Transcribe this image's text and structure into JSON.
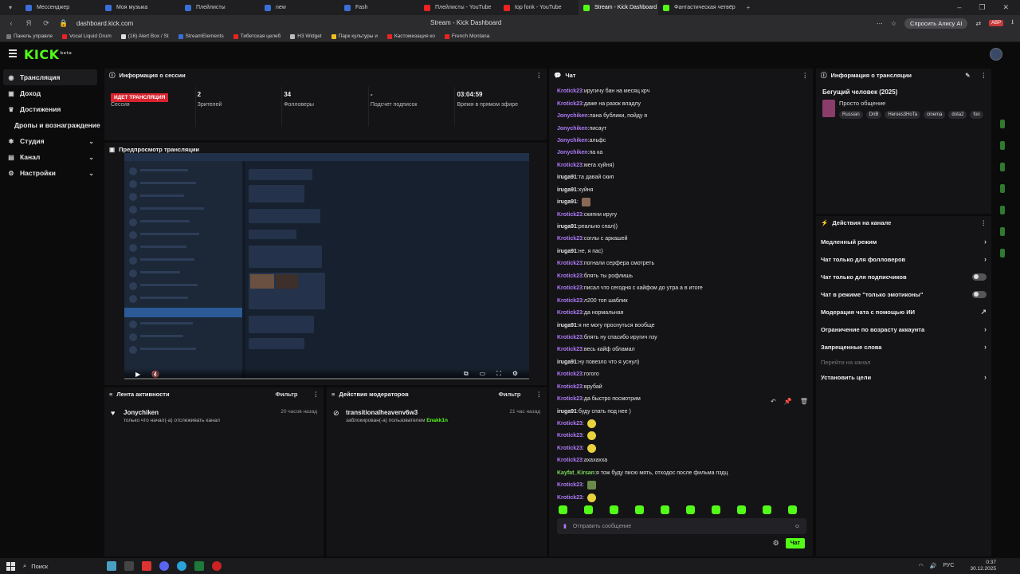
{
  "browser": {
    "tabs": [
      {
        "label": "Мессенджер",
        "color": "#3b6fd8"
      },
      {
        "label": "Моя музыка",
        "color": "#3b6fd8"
      },
      {
        "label": "Плейлисты",
        "color": "#3b6fd8"
      },
      {
        "label": "new",
        "color": "#3b6fd8"
      },
      {
        "label": "Fash",
        "color": "#3b6fd8"
      },
      {
        "label": "Плейлисты - YouTube",
        "color": "#e22"
      },
      {
        "label": "top fonk - YouTube",
        "color": "#e22"
      },
      {
        "label": "Stream - Kick Dashboard",
        "color": "#53fc18"
      },
      {
        "label": "Фантастическая четвёр",
        "color": "#53fc18"
      }
    ],
    "url": "dashboard.kick.com",
    "page_title": "Stream - Kick Dashboard",
    "alisa_label": "Спросить Алису AI",
    "abp": "ABP",
    "bookmarks": [
      {
        "label": "Панель управле",
        "color": "#777"
      },
      {
        "label": "Vocal Liquid Drum",
        "color": "#e22"
      },
      {
        "label": "(16) Alert Box / St",
        "color": "#ddd"
      },
      {
        "label": "StreamElements",
        "color": "#3b6fd8"
      },
      {
        "label": "Тибетская целеб",
        "color": "#e22"
      },
      {
        "label": "H3 Widget",
        "color": "#bbb"
      },
      {
        "label": "Парк культуры и",
        "color": "#f0c020"
      },
      {
        "label": "Кастомизация ко",
        "color": "#e22"
      },
      {
        "label": "French Montana",
        "color": "#e22"
      }
    ]
  },
  "app": {
    "logo": "KICK",
    "logo_sup": "beta"
  },
  "sidebar": {
    "items": [
      {
        "label": "Трансляция",
        "icon": "(•)"
      },
      {
        "label": "Доход",
        "icon": "▣"
      },
      {
        "label": "Достижения",
        "icon": "🏆"
      },
      {
        "label": "Дропы и вознаграждение",
        "icon": ""
      },
      {
        "label": "Студия",
        "icon": "⚙"
      },
      {
        "label": "Канал",
        "icon": "▤"
      },
      {
        "label": "Настройки",
        "icon": "⚙"
      }
    ]
  },
  "session": {
    "title": "Информация о сессии",
    "live_badge": "ИДЕТ ТРАНСЛЯЦИЯ",
    "stats": [
      {
        "value": "",
        "label": "Сессия"
      },
      {
        "value": "2",
        "label": "Зрителей"
      },
      {
        "value": "34",
        "label": "Фолловеры"
      },
      {
        "value": "-",
        "label": "Подсчет подписок"
      },
      {
        "value": "03:04:59",
        "label": "Время в прямом эфире"
      }
    ]
  },
  "preview": {
    "title": "Предпросмотр трансляции"
  },
  "activity": {
    "title": "Лента активности",
    "filter": "Фильтр",
    "items": [
      {
        "name": "Jonychiken",
        "desc": "только что начал(-а) отслеживать канал",
        "time": "20 часов назад"
      }
    ]
  },
  "moderators": {
    "title": "Действия модераторов",
    "filter": "Фильтр",
    "items": [
      {
        "name": "transitionalheavenv6w3",
        "desc": "заблокирован(-а) пользователем",
        "by": "Enakk1n",
        "time": "21 час назад"
      }
    ]
  },
  "chat": {
    "title": "Чат",
    "messages": [
      {
        "user": "Krotick23",
        "text": "иругичу бан на месяц крч",
        "cls": "u-kr"
      },
      {
        "user": "Krotick23",
        "text": "даже на разок владлу",
        "cls": "u-kr"
      },
      {
        "user": "Jonychiken",
        "text": "лана бублики, пойду я",
        "cls": "u-jo"
      },
      {
        "user": "Jonychiken",
        "text": "писаут",
        "cls": "u-jo"
      },
      {
        "user": "Jonychiken",
        "text": "альфс",
        "cls": "u-jo"
      },
      {
        "user": "Jonychiken",
        "text": "па ка",
        "cls": "u-jo"
      },
      {
        "user": "Krotick23",
        "text": "мега хуйня)",
        "cls": "u-kr"
      },
      {
        "user": "iruga91",
        "text": "та давай скип",
        "cls": "u-ir"
      },
      {
        "user": "iruga91",
        "text": "хуйня",
        "cls": "u-ir"
      },
      {
        "user": "iruga91",
        "text": "",
        "cls": "u-ir",
        "emote": "brown"
      },
      {
        "user": "Krotick23",
        "text": "скипни иругу",
        "cls": "u-kr"
      },
      {
        "user": "iruga91",
        "text": "реально спал))",
        "cls": "u-ir"
      },
      {
        "user": "Krotick23",
        "text": "соглы с аркашей",
        "cls": "u-kr"
      },
      {
        "user": "iruga91",
        "text": "не, я пас)",
        "cls": "u-ir"
      },
      {
        "user": "Krotick23",
        "text": "погнали серфера смотреть",
        "cls": "u-kr"
      },
      {
        "user": "Krotick23",
        "text": "блять ты рофлишь",
        "cls": "u-kr"
      },
      {
        "user": "Krotick23",
        "text": "писал что сегодня с кайфом до утра а в итоге",
        "cls": "u-kr"
      },
      {
        "user": "Krotick23",
        "text": "л200 топ шаблик",
        "cls": "u-kr"
      },
      {
        "user": "Krotick23",
        "text": "да нормальная",
        "cls": "u-kr"
      },
      {
        "user": "iruga91",
        "text": "я не могу проснуться вообще",
        "cls": "u-ir"
      },
      {
        "user": "Krotick23",
        "text": "блять ну спасибо иругич пзу",
        "cls": "u-kr"
      },
      {
        "user": "Krotick23",
        "text": "весь кайф обламал",
        "cls": "u-kr"
      },
      {
        "user": "iruga91",
        "text": "ну повезло что я уснул)",
        "cls": "u-ir"
      },
      {
        "user": "Krotick23",
        "text": "гогого",
        "cls": "u-kr"
      },
      {
        "user": "Krotick23",
        "text": "врубай",
        "cls": "u-kr"
      },
      {
        "user": "Krotick23",
        "text": "да быстро посмотрим",
        "cls": "u-kr"
      },
      {
        "user": "iruga91",
        "text": "буду спать под нее )",
        "cls": "u-ir"
      },
      {
        "user": "Krotick23",
        "text": "",
        "cls": "u-kr",
        "emote": "yellow"
      },
      {
        "user": "Krotick23",
        "text": "",
        "cls": "u-kr",
        "emote": "yellow"
      },
      {
        "user": "Krotick23",
        "text": "",
        "cls": "u-kr",
        "emote": "yellow"
      },
      {
        "user": "Krotick23",
        "text": "ахахахха",
        "cls": "u-kr"
      },
      {
        "user": "Kayfat_Kirsan",
        "text": "я тож буду писю мять, отходос после фильма пздц",
        "cls": "u-ka"
      },
      {
        "user": "Krotick23",
        "text": "",
        "cls": "u-kr",
        "emote": "green2"
      },
      {
        "user": "Krotick23",
        "text": "",
        "cls": "u-kr",
        "emote": "yellow"
      }
    ],
    "input_placeholder": "Отправить сообщение",
    "send_label": "Чат"
  },
  "stream_info": {
    "title": "Информация о трансляции",
    "stream_title": "Бегущий человек (2025)",
    "category": "Просто общение",
    "tags": [
      "Russian",
      "DnB",
      "Heroes3HoTa",
      "cinema",
      "dota2",
      "fon"
    ]
  },
  "channel_actions": {
    "title": "Действия на канале",
    "items": [
      {
        "label": "Медленный режим",
        "end": "chevron"
      },
      {
        "label": "Чат только для фолловеров",
        "end": "chevron"
      },
      {
        "label": "Чат только для подписчиков",
        "end": "toggle"
      },
      {
        "label": "Чат в режиме \"только эмотиконы\"",
        "end": "toggle"
      },
      {
        "label": "Модерация чата с помощью ИИ",
        "end": "external"
      },
      {
        "label": "Ограничение по возрасту аккаунта",
        "end": "chevron"
      },
      {
        "label": "Запрещенные слова",
        "end": "chevron"
      },
      {
        "label": "Перейти на канал",
        "end": "none",
        "dim": true
      },
      {
        "label": "Установить цели",
        "end": "chevron"
      }
    ]
  },
  "taskbar": {
    "search": "Поиск",
    "lang": "РУС",
    "time": "0:37",
    "date": "30.12.2025"
  }
}
